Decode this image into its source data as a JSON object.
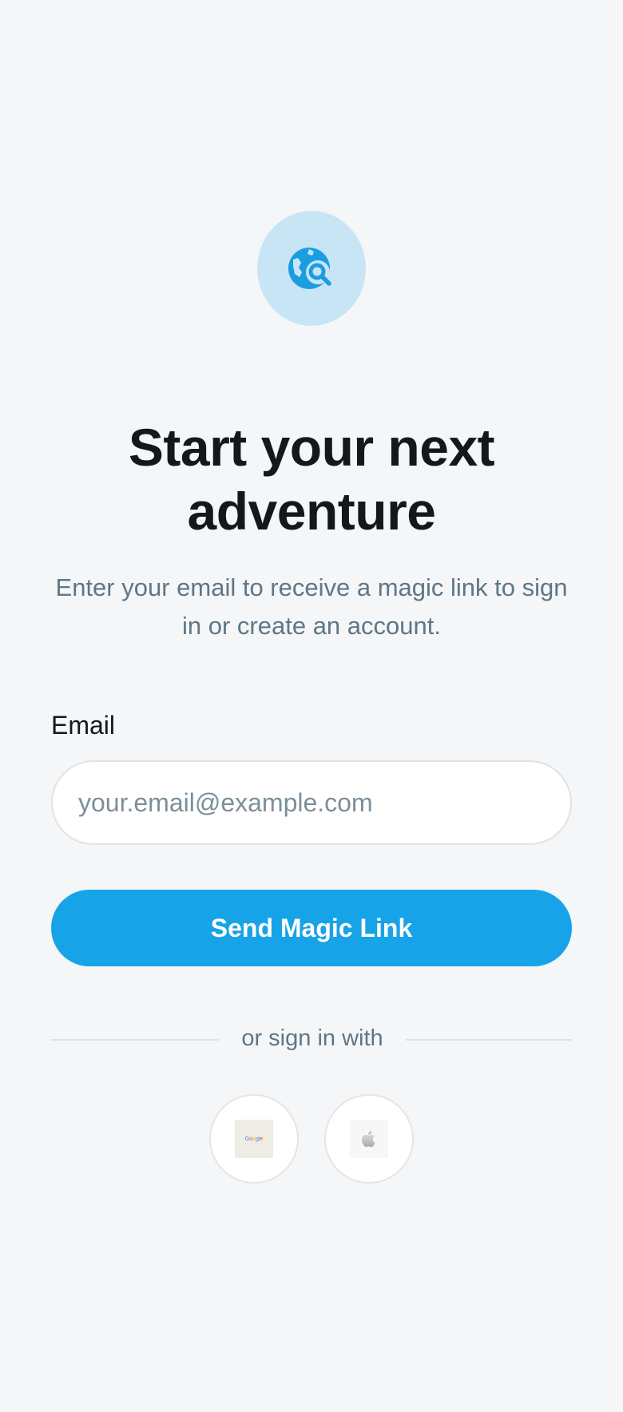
{
  "hero": {
    "icon": "travel-explore-icon",
    "accent": "#1a9ee0",
    "background": "#c8e5f6"
  },
  "title": "Start your next adventure",
  "subtitle": "Enter your email to receive a magic link to sign in or create an account.",
  "form": {
    "email_label": "Email",
    "email_placeholder": "your.email@example.com",
    "email_value": "",
    "submit_label": "Send Magic Link",
    "submit_color": "#17a3e8"
  },
  "divider": {
    "text": "or sign in with"
  },
  "social": {
    "google": {
      "icon": "google-logo",
      "wordmark": [
        "G",
        "o",
        "o",
        "g",
        "l",
        "e"
      ]
    },
    "apple": {
      "icon": "apple-logo"
    }
  }
}
